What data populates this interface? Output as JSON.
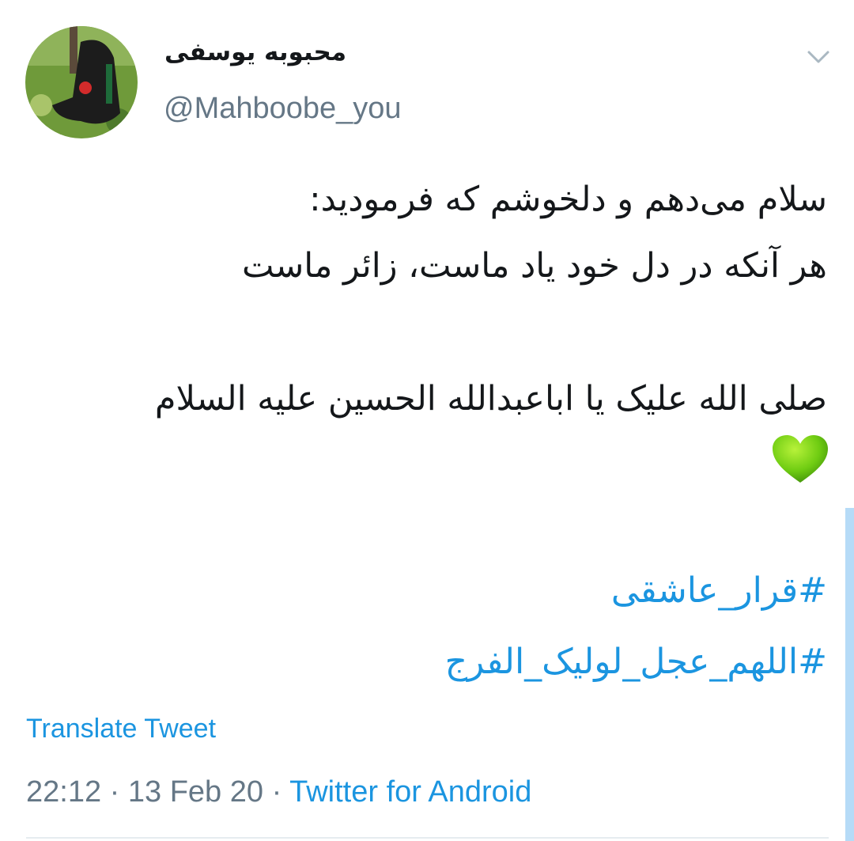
{
  "user": {
    "display_name": "محبوبه یوسفی",
    "handle": "@Mahboobe_you",
    "avatar_icon": "avatar-photo"
  },
  "tweet": {
    "lines": [
      "سلام می‌دهم و دلخوشم که فرمودید:",
      "هر آنکه در دل خود یاد ماست، زائر ماست",
      "",
      "صلی الله علیک یا اباعبدالله الحسین علیه السلام"
    ],
    "emoji": "green-heart",
    "hashtags": [
      "#قرار_عاشقی",
      "#اللهم_عجل_لولیک_الفرج"
    ]
  },
  "actions": {
    "translate_label": "Translate Tweet",
    "menu_icon": "chevron-down-icon"
  },
  "meta": {
    "time": "22:12",
    "separator": "·",
    "date": "13 Feb 20",
    "source": "Twitter for Android"
  },
  "colors": {
    "link": "#1b95e0",
    "secondary_text": "#657786",
    "primary_text": "#14171a",
    "heart": "#7fd11b"
  }
}
